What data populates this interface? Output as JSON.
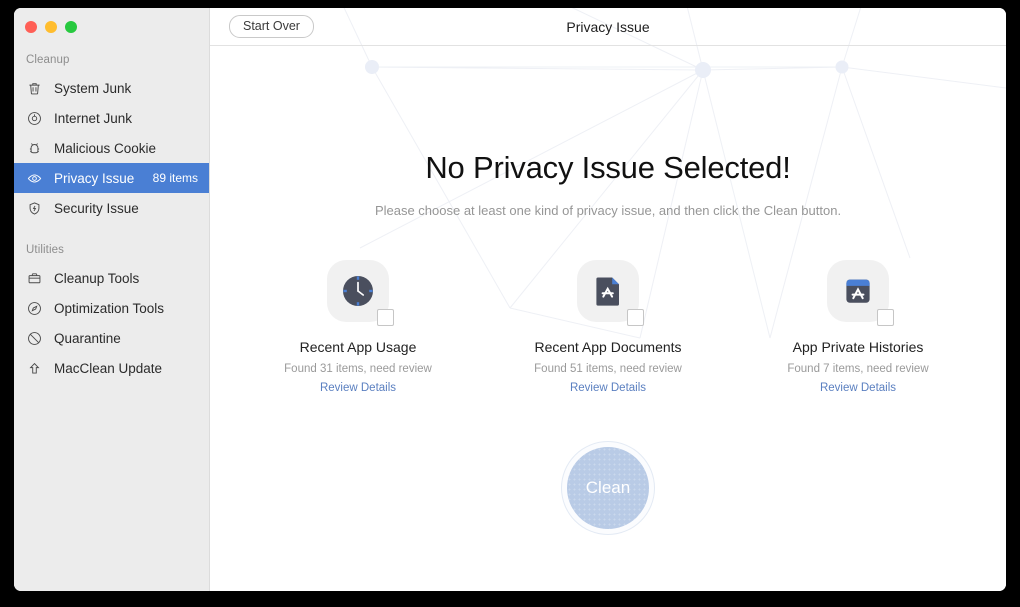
{
  "window": {
    "traffic_lights": [
      {
        "name": "close",
        "color": "#ff5f56"
      },
      {
        "name": "minimize",
        "color": "#ffbd2e"
      },
      {
        "name": "zoom",
        "color": "#27c93f"
      }
    ]
  },
  "sidebar": {
    "groups": [
      {
        "label": "Cleanup",
        "items": [
          {
            "label": "System Junk",
            "icon": "trash-icon",
            "count": "",
            "selected": false
          },
          {
            "label": "Internet Junk",
            "icon": "compass-icon",
            "count": "",
            "selected": false
          },
          {
            "label": "Malicious Cookie",
            "icon": "cookie-icon",
            "count": "",
            "selected": false
          },
          {
            "label": "Privacy Issue",
            "icon": "eye-icon",
            "count": "89 items",
            "selected": true
          },
          {
            "label": "Security Issue",
            "icon": "shield-icon",
            "count": "",
            "selected": false
          }
        ]
      },
      {
        "label": "Utilities",
        "items": [
          {
            "label": "Cleanup Tools",
            "icon": "toolbox-icon",
            "count": "",
            "selected": false
          },
          {
            "label": "Optimization Tools",
            "icon": "gauge-icon",
            "count": "",
            "selected": false
          },
          {
            "label": "Quarantine",
            "icon": "no-entry-icon",
            "count": "",
            "selected": false
          },
          {
            "label": "MacClean Update",
            "icon": "up-arrow-icon",
            "count": "",
            "selected": false
          }
        ]
      }
    ],
    "selected_bg": "#4a7fd4"
  },
  "topbar": {
    "start_over_label": "Start Over",
    "title": "Privacy Issue"
  },
  "main": {
    "headline": "No Privacy Issue Selected!",
    "subhead": "Please choose at least one kind of privacy issue, and then click the Clean button.",
    "tiles": [
      {
        "title": "Recent App Usage",
        "subtitle": "Found 31 items, need review",
        "link": "Review Details",
        "icon": "clock-icon",
        "checked": false
      },
      {
        "title": "Recent App Documents",
        "subtitle": "Found 51 items, need review",
        "link": "Review Details",
        "icon": "app-document-icon",
        "checked": false
      },
      {
        "title": "App Private Histories",
        "subtitle": "Found 7 items, need review",
        "link": "Review Details",
        "icon": "app-store-icon",
        "checked": false
      }
    ],
    "clean_button": {
      "label": "Clean",
      "fill": "#b9cbe6",
      "enabled": false
    },
    "link_color": "#5a7fc0"
  }
}
